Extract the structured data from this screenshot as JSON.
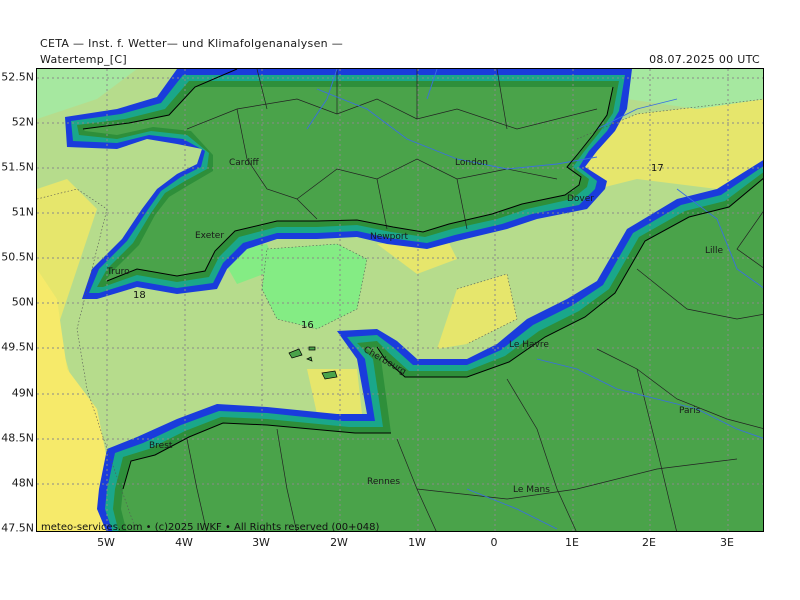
{
  "header": {
    "title": "CETA — Inst. f. Wetter— und Klimafolgenanalysen —",
    "variable": "Watertemp_[C]",
    "datetime": "08.07.2025 00 UTC"
  },
  "axes": {
    "lat_labels": [
      "52.5N",
      "52N",
      "51.5N",
      "51N",
      "50.5N",
      "50N",
      "49.5N",
      "49N",
      "48.5N",
      "48N",
      "47.5N"
    ],
    "lon_labels": [
      "5W",
      "4W",
      "3W",
      "2W",
      "1W",
      "0",
      "1E",
      "2E",
      "3E"
    ]
  },
  "map": {
    "cities": [
      "Cardiff",
      "London",
      "Dover",
      "Lille",
      "Exeter",
      "Newport",
      "Truro",
      "Cherbourg",
      "Le Havre",
      "Paris",
      "Brest",
      "Rennes",
      "Le Mans"
    ],
    "contour_labels": [
      "17",
      "18",
      "16"
    ],
    "credit": "meteo-services.com • (c)2025 IWKF • All Rights reserved (00+048)"
  },
  "colors": {
    "land": "#4aa34a",
    "sea_16": "#84ec84",
    "sea_16_17": "#b6dc8c",
    "sea_17": "#e6e66c",
    "sea_18": "#f6ea6a",
    "coast_dark_green": "#2e8f3a",
    "coast_teal": "#1aa78a",
    "coast_blue": "#1a3cdc",
    "rivers": "#3a6fe0",
    "grid": "#8a8a8a"
  }
}
